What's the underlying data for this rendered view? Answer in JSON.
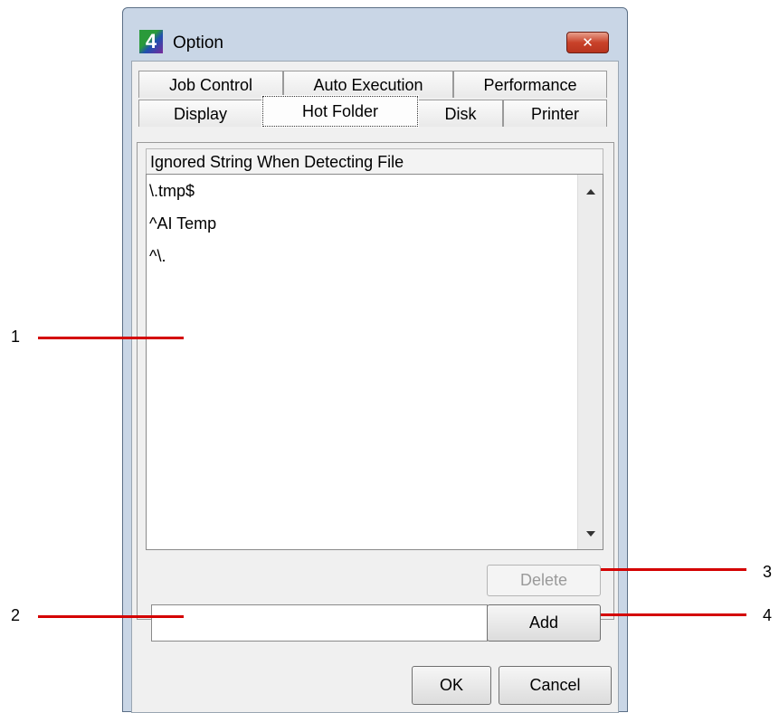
{
  "window": {
    "title": "Option",
    "close_icon": "close-icon"
  },
  "tabs": {
    "row1": [
      "Job Control",
      "Auto Execution",
      "Performance"
    ],
    "row2": [
      "Display",
      "Hot Folder",
      "Disk",
      "Printer"
    ],
    "active": "Hot Folder"
  },
  "hot_folder": {
    "list_header": "Ignored String When Detecting File",
    "items": [
      "\\.tmp$",
      "^AI Temp",
      "^\\."
    ],
    "input_value": "",
    "delete_label": "Delete",
    "add_label": "Add"
  },
  "footer": {
    "ok_label": "OK",
    "cancel_label": "Cancel"
  },
  "callouts": [
    "1",
    "2",
    "3",
    "4"
  ],
  "colors": {
    "callout_line": "#d40000",
    "close_button": "#c9422a",
    "window_frame": "#c9d6e6"
  }
}
